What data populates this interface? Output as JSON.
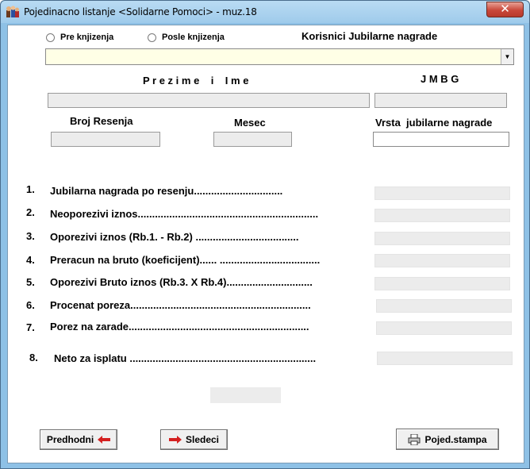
{
  "window": {
    "title": "Pojedinacno listanje <Solidarne Pomoci> - muz.18",
    "close_label": "✕"
  },
  "options": {
    "pre": "Pre knjizenja",
    "posle": "Posle knjizenja",
    "korisnici": "Korisnici Jubilarne nagrade"
  },
  "combo": {
    "value": ""
  },
  "labels": {
    "prezime": "P r e z i m e    i    I m e",
    "jmbg": "J M B G",
    "broj": "Broj Resenja",
    "mesec": "Mesec",
    "vrsta": "Vrsta  jubilarne nagrade"
  },
  "fields": {
    "prezime": "",
    "jmbg": "",
    "broj": "",
    "mesec": "",
    "vrsta": ""
  },
  "rows": [
    {
      "num": "1.",
      "text": "Jubilarna nagrada po resenju...............................",
      "value": ""
    },
    {
      "num": "2.",
      "text": "Neoporezivi iznos...............................................................",
      "value": ""
    },
    {
      "num": "3.",
      "text": "Oporezivi iznos (Rb.1. - Rb.2) ....................................",
      "value": ""
    },
    {
      "num": "4.",
      "text": "Preracun na bruto (koeficijent)...... ...................................",
      "value": ""
    },
    {
      "num": "5.",
      "text": "Oporezivi Bruto iznos (Rb.3. X Rb.4)..............................",
      "value": ""
    },
    {
      "num": "6.",
      "text": "Procenat poreza...............................................................",
      "value": ""
    },
    {
      "num": "7.",
      "text": "Porez na zarade...............................................................",
      "value": ""
    },
    {
      "num": "8.",
      "text": "Neto za isplatu .................................................................",
      "value": ""
    }
  ],
  "buttons": {
    "prev": "Predhodni",
    "next": "Sledeci",
    "print": "Poјed.stampa"
  },
  "colors": {
    "title_bar": "#9fcbeb",
    "close": "#c9483a",
    "combo_bg": "#ffffe6",
    "arrow_red": "#d42020"
  }
}
